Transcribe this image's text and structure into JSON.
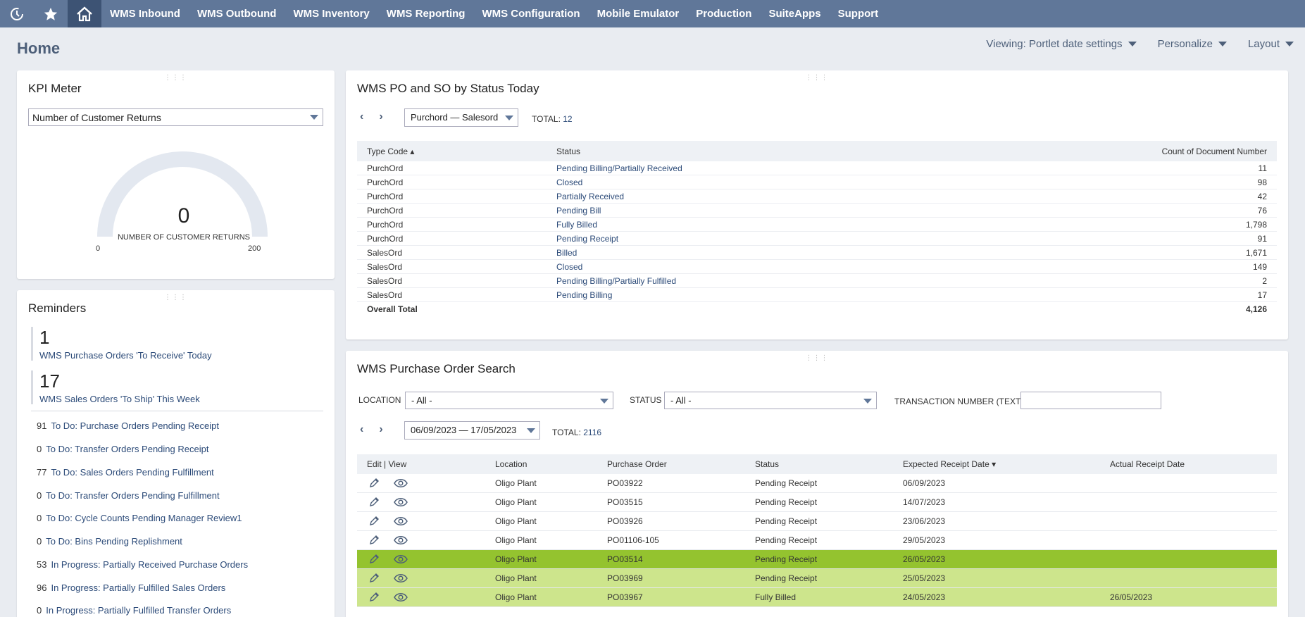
{
  "nav": {
    "icons": [
      "recent-icon",
      "star-icon",
      "home-icon"
    ],
    "items": [
      "WMS Inbound",
      "WMS Outbound",
      "WMS Inventory",
      "WMS Reporting",
      "WMS Configuration",
      "Mobile Emulator",
      "Production",
      "SuiteApps",
      "Support"
    ]
  },
  "page": {
    "title": "Home",
    "actions": [
      "Viewing: Portlet date settings",
      "Personalize",
      "Layout"
    ]
  },
  "kpi": {
    "title": "KPI Meter",
    "selected": "Number of Customer Returns",
    "value": "0",
    "caption": "NUMBER OF CUSTOMER RETURNS",
    "min": "0",
    "max": "200"
  },
  "reminders": {
    "title": "Reminders",
    "big": [
      {
        "num": "1",
        "label": "WMS Purchase Orders 'To Receive' Today"
      },
      {
        "num": "17",
        "label": "WMS Sales Orders 'To Ship' This Week"
      }
    ],
    "items": [
      {
        "num": "91",
        "label": "To Do: Purchase Orders Pending Receipt"
      },
      {
        "num": "0",
        "label": "To Do: Transfer Orders Pending Receipt"
      },
      {
        "num": "77",
        "label": "To Do: Sales Orders Pending Fulfillment"
      },
      {
        "num": "0",
        "label": "To Do: Transfer Orders Pending Fulfillment"
      },
      {
        "num": "0",
        "label": "To Do: Cycle Counts Pending Manager Review1"
      },
      {
        "num": "0",
        "label": "To Do: Bins Pending Replishment"
      },
      {
        "num": "53",
        "label": "In Progress: Partially Received Purchase Orders"
      },
      {
        "num": "96",
        "label": "In Progress: Partially Fulfilled Sales Orders"
      },
      {
        "num": "0",
        "label": "In Progress: Partially Fulfilled Transfer Orders"
      }
    ]
  },
  "status_portlet": {
    "title": "WMS PO and SO by Status Today",
    "filter": "Purchord — Salesord",
    "total_label": "TOTAL:",
    "total_value": "12",
    "columns": [
      "Type Code ▴",
      "Status",
      "Count of Document Number"
    ],
    "rows": [
      [
        "PurchOrd",
        "Pending Billing/Partially Received",
        "11"
      ],
      [
        "PurchOrd",
        "Closed",
        "98"
      ],
      [
        "PurchOrd",
        "Partially Received",
        "42"
      ],
      [
        "PurchOrd",
        "Pending Bill",
        "76"
      ],
      [
        "PurchOrd",
        "Fully Billed",
        "1,798"
      ],
      [
        "PurchOrd",
        "Pending Receipt",
        "91"
      ],
      [
        "SalesOrd",
        "Billed",
        "1,671"
      ],
      [
        "SalesOrd",
        "Closed",
        "149"
      ],
      [
        "SalesOrd",
        "Pending Billing/Partially Fulfilled",
        "2"
      ],
      [
        "SalesOrd",
        "Pending Billing",
        "17"
      ]
    ],
    "overall_label": "Overall Total",
    "overall_value": "4,126"
  },
  "po_search": {
    "title": "WMS Purchase Order Search",
    "location_label": "LOCATION",
    "location_value": "- All -",
    "status_label": "STATUS",
    "status_value": "- All -",
    "txn_label": "TRANSACTION NUMBER (TEXT)",
    "txn_value": "",
    "date_range": "06/09/2023 — 17/05/2023",
    "total_label": "TOTAL:",
    "total_value": "2116",
    "columns": [
      "Edit | View",
      "Location",
      "Purchase Order",
      "Status",
      "Expected Receipt Date ▾",
      "Actual Receipt Date"
    ],
    "rows": [
      [
        "Oligo Plant",
        "PO03922",
        "Pending Receipt",
        "06/09/2023",
        ""
      ],
      [
        "Oligo Plant",
        "PO03515",
        "Pending Receipt",
        "14/07/2023",
        ""
      ],
      [
        "Oligo Plant",
        "PO03926",
        "Pending Receipt",
        "23/06/2023",
        ""
      ],
      [
        "Oligo Plant",
        "PO01106-105",
        "Pending Receipt",
        "29/05/2023",
        ""
      ],
      [
        "Oligo Plant",
        "PO03514",
        "Pending Receipt",
        "26/05/2023",
        ""
      ],
      [
        "Oligo Plant",
        "PO03969",
        "Pending Receipt",
        "25/05/2023",
        ""
      ],
      [
        "Oligo Plant",
        "PO03967",
        "Fully Billed",
        "24/05/2023",
        "26/05/2023"
      ]
    ],
    "highlight_colors": [
      "#94c32f",
      "#cde58c"
    ]
  }
}
